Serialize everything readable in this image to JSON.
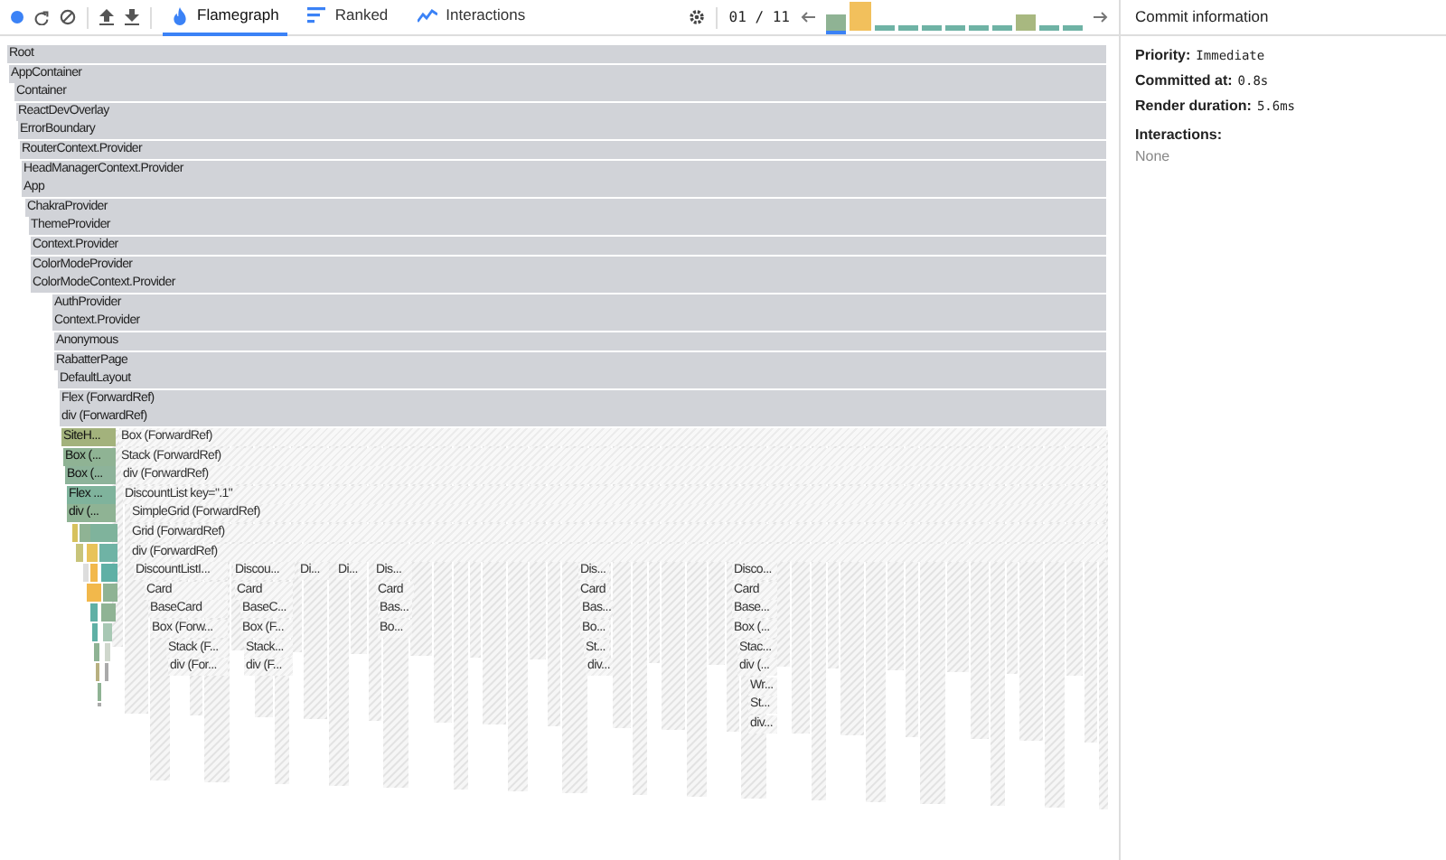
{
  "toolbar": {
    "tabs": [
      {
        "label": "Flamegraph",
        "selected": true
      },
      {
        "label": "Ranked",
        "selected": false
      },
      {
        "label": "Interactions",
        "selected": false
      }
    ],
    "commit_counter": "01 / 11"
  },
  "flamegraph": {
    "rows": [
      {
        "bars": [
          {
            "label": "Root",
            "kind": "grey"
          }
        ]
      },
      {
        "bars": [
          {
            "label": "AppContainer",
            "kind": "grey"
          }
        ]
      },
      {
        "bars": [
          {
            "label": "Container",
            "kind": "grey"
          }
        ]
      },
      {
        "bars": [
          {
            "label": "ReactDevOverlay",
            "kind": "grey"
          }
        ]
      },
      {
        "bars": [
          {
            "label": "ErrorBoundary",
            "kind": "grey"
          }
        ]
      },
      {
        "bars": [
          {
            "label": "RouterContext.Provider",
            "kind": "grey"
          }
        ]
      },
      {
        "bars": [
          {
            "label": "HeadManagerContext.Provider",
            "kind": "grey"
          }
        ]
      },
      {
        "bars": [
          {
            "label": "App",
            "kind": "grey"
          }
        ]
      },
      {
        "bars": [
          {
            "label": "ChakraProvider",
            "kind": "grey"
          }
        ]
      },
      {
        "bars": [
          {
            "label": "ThemeProvider",
            "kind": "grey"
          }
        ]
      },
      {
        "bars": [
          {
            "label": "Context.Provider",
            "kind": "grey"
          }
        ]
      },
      {
        "bars": [
          {
            "label": "ColorModeProvider",
            "kind": "grey"
          }
        ]
      },
      {
        "bars": [
          {
            "label": "ColorModeContext.Provider",
            "kind": "grey"
          }
        ]
      },
      {
        "bars": [
          {
            "label": "AuthProvider",
            "kind": "grey"
          }
        ]
      },
      {
        "bars": [
          {
            "label": "Context.Provider",
            "kind": "grey"
          }
        ]
      },
      {
        "bars": [
          {
            "label": "Anonymous",
            "kind": "grey"
          }
        ]
      },
      {
        "bars": [
          {
            "label": "RabatterPage",
            "kind": "grey"
          }
        ]
      },
      {
        "bars": [
          {
            "label": "DefaultLayout",
            "kind": "grey"
          }
        ]
      },
      {
        "bars": [
          {
            "label": "Flex (ForwardRef)",
            "kind": "grey"
          }
        ]
      },
      {
        "bars": [
          {
            "label": "div (ForwardRef)",
            "kind": "grey"
          }
        ]
      },
      {
        "bars": [
          {
            "label": "SiteH...",
            "kind": "colored",
            "color": "#a3b27c"
          },
          {
            "label": "Box (ForwardRef)",
            "kind": "hatched"
          }
        ]
      },
      {
        "bars": [
          {
            "label": "Box (...",
            "kind": "colored",
            "color": "#8fb394"
          },
          {
            "label": "Stack (ForwardRef)",
            "kind": "hatched"
          }
        ]
      },
      {
        "bars": [
          {
            "label": "Box (...",
            "kind": "colored",
            "color": "#8db39a"
          },
          {
            "label": "div (ForwardRef)",
            "kind": "hatched"
          }
        ]
      },
      {
        "bars": [
          {
            "label": "Flex ...",
            "kind": "colored",
            "color": "#7fb39c"
          },
          {
            "label": "DiscountList key=\".1\"",
            "kind": "hatched"
          }
        ]
      },
      {
        "bars": [
          {
            "label": "div (...",
            "kind": "colored",
            "color": "#8fb394"
          },
          {
            "label": "SimpleGrid (ForwardRef)",
            "kind": "hatched"
          }
        ]
      },
      {
        "bars": [
          {
            "label": "Grid (ForwardRef)",
            "kind": "hatched"
          }
        ]
      },
      {
        "bars": [
          {
            "label": "div (ForwardRef)",
            "kind": "hatched"
          }
        ]
      },
      {
        "bars": [
          {
            "label": "DiscountListI...",
            "kind": "hatched"
          },
          {
            "label": "Discou...",
            "kind": "hatched"
          },
          {
            "label": "Di...",
            "kind": "hatched"
          },
          {
            "label": "Di...",
            "kind": "hatched"
          },
          {
            "label": "Dis...",
            "kind": "hatched"
          },
          {
            "label": "Dis...",
            "kind": "hatched"
          },
          {
            "label": "Disco...",
            "kind": "hatched"
          }
        ]
      },
      {
        "bars": [
          {
            "label": "Card",
            "kind": "hatched"
          },
          {
            "label": "Card",
            "kind": "hatched"
          },
          {
            "label": "Card",
            "kind": "hatched"
          },
          {
            "label": "Card",
            "kind": "hatched"
          },
          {
            "label": "Card",
            "kind": "hatched"
          }
        ]
      },
      {
        "bars": [
          {
            "label": "BaseCard",
            "kind": "hatched"
          },
          {
            "label": "BaseC...",
            "kind": "hatched"
          },
          {
            "label": "Bas...",
            "kind": "hatched"
          },
          {
            "label": "Bas...",
            "kind": "hatched"
          },
          {
            "label": "Base...",
            "kind": "hatched"
          }
        ]
      },
      {
        "bars": [
          {
            "label": "Box (Forw...",
            "kind": "hatched"
          },
          {
            "label": "Box (F...",
            "kind": "hatched"
          },
          {
            "label": "Bo...",
            "kind": "hatched"
          },
          {
            "label": "Bo...",
            "kind": "hatched"
          },
          {
            "label": "Box (...",
            "kind": "hatched"
          }
        ]
      },
      {
        "bars": [
          {
            "label": "Stack (F...",
            "kind": "hatched"
          },
          {
            "label": "Stack...",
            "kind": "hatched"
          },
          {
            "label": "St...",
            "kind": "hatched"
          },
          {
            "label": "Stac...",
            "kind": "hatched"
          }
        ]
      },
      {
        "bars": [
          {
            "label": "div (For...",
            "kind": "hatched"
          },
          {
            "label": "div (F...",
            "kind": "hatched"
          },
          {
            "label": "div...",
            "kind": "hatched"
          },
          {
            "label": "div (...",
            "kind": "hatched"
          }
        ]
      },
      {
        "bars": [
          {
            "label": "Wr...",
            "kind": "hatched"
          }
        ]
      },
      {
        "bars": [
          {
            "label": "St...",
            "kind": "hatched"
          }
        ]
      },
      {
        "bars": [
          {
            "label": "div...",
            "kind": "hatched"
          }
        ]
      }
    ]
  },
  "commit_panel": {
    "title": "Commit information",
    "fields": [
      {
        "label": "Priority:",
        "value": "Immediate"
      },
      {
        "label": "Committed at:",
        "value": "0.8s"
      },
      {
        "label": "Render duration:",
        "value": "5.6ms"
      }
    ],
    "interactions_label": "Interactions:",
    "interactions_value": "None"
  }
}
